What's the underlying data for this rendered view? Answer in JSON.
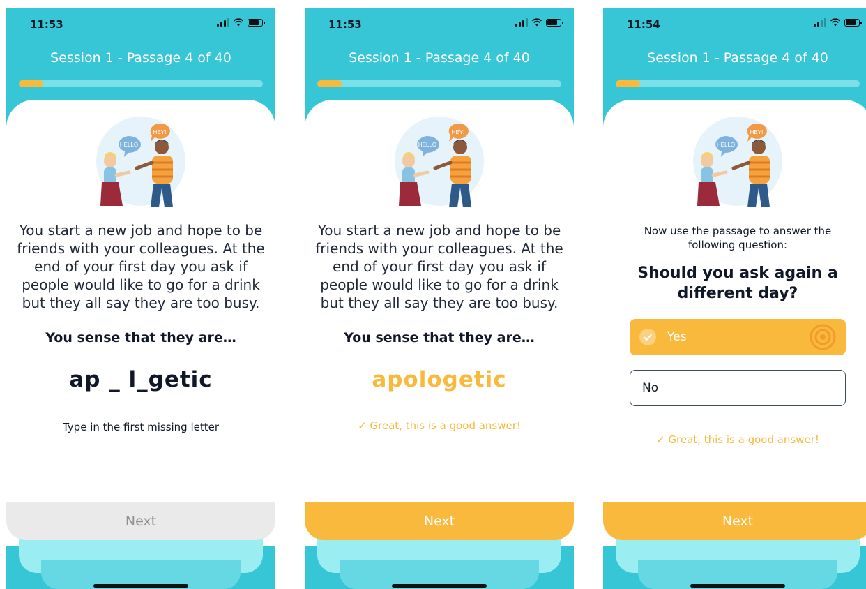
{
  "screens": [
    {
      "time": "11:53",
      "session_title": "Session 1 - Passage 4 of 40",
      "progress": 0.1,
      "speech_bubbles": [
        "HEY!",
        "HELLO"
      ],
      "passage": "You start a new job and hope to be friends with your colleagues.  At the end of your first day you ask if people would like to go for a drink but they all say they are too busy.",
      "prompt": "You sense that they are…",
      "word": "ap _ l_getic",
      "hint": "Type in the first missing letter",
      "next_label": "Next",
      "next_state": "disabled"
    },
    {
      "time": "11:53",
      "session_title": "Session 1 - Passage 4 of 40",
      "progress": 0.1,
      "speech_bubbles": [
        "HEY!",
        "HELLO"
      ],
      "passage": "You start a new job and hope to be friends with your colleagues.  At the end of your first day you ask if people would like to go for a drink but they all say they are too busy.",
      "prompt": "You sense that they are…",
      "word": "apologetic",
      "feedback": "✓ Great, this is a good answer!",
      "next_label": "Next",
      "next_state": "active"
    },
    {
      "time": "11:54",
      "session_title": "Session 1 - Passage 4 of 40",
      "progress": 0.1,
      "speech_bubbles": [
        "HEY!",
        "HELLO"
      ],
      "question_intro": "Now use the passage to answer the following question:",
      "question": "Should you ask again a different day?",
      "options": [
        {
          "label": "Yes",
          "selected": true
        },
        {
          "label": "No",
          "selected": false
        }
      ],
      "feedback": "✓ Great, this is a good answer!",
      "next_label": "Next",
      "next_state": "active"
    }
  ],
  "colors": {
    "teal": "#37c6d6",
    "accent": "#f8b93c",
    "disabled": "#eaeaea",
    "text": "#101828"
  }
}
